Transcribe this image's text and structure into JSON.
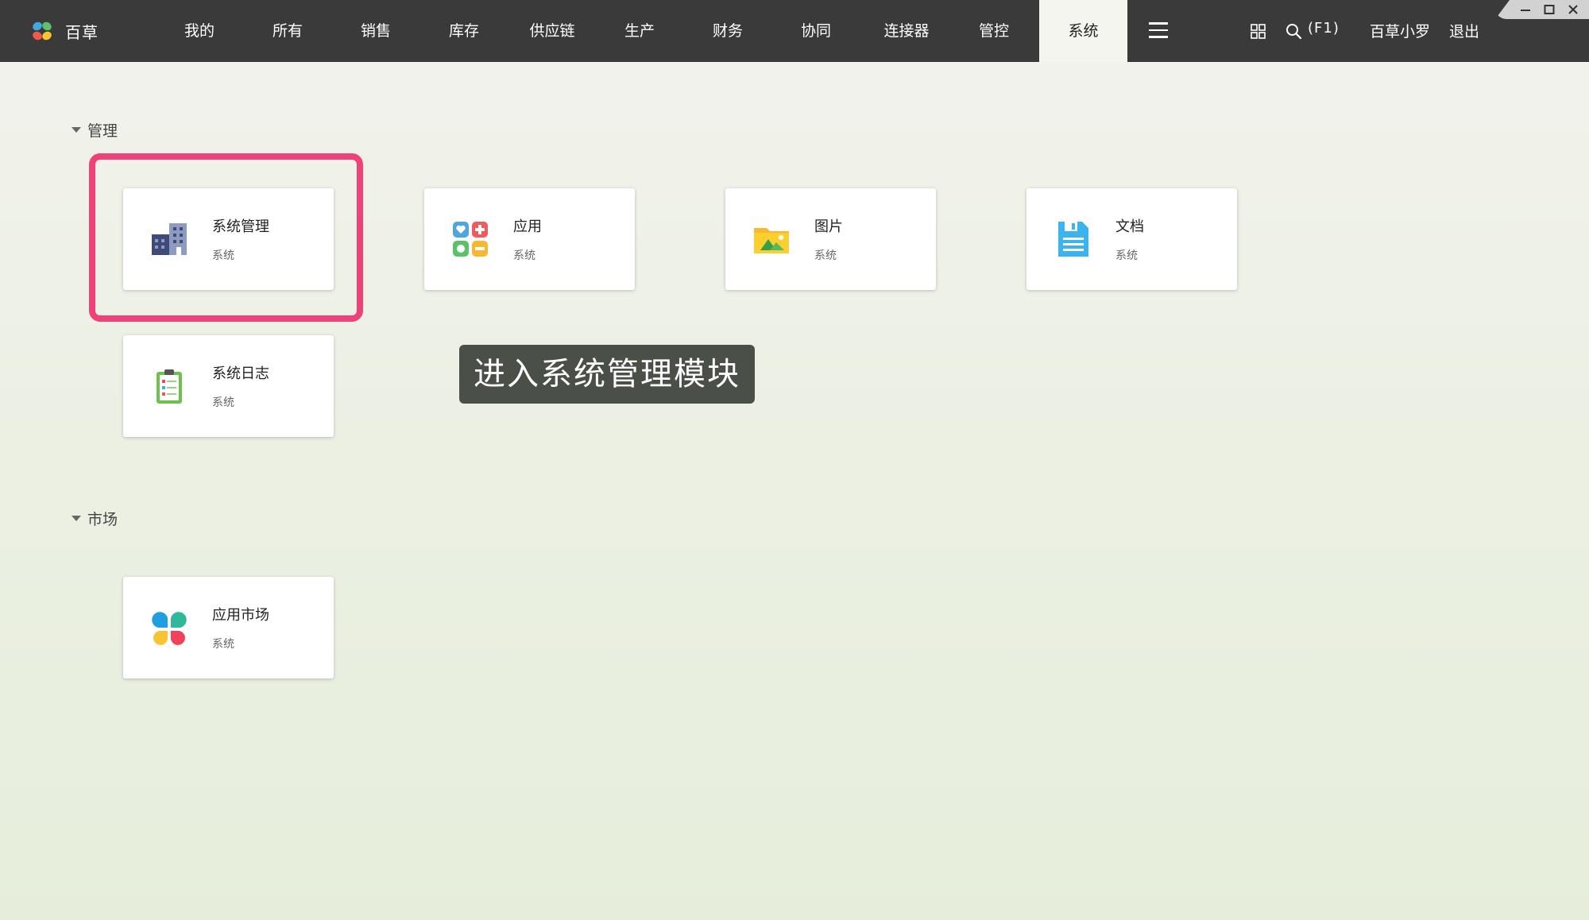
{
  "app": {
    "name": "百草"
  },
  "nav": {
    "items": [
      {
        "label": "我的"
      },
      {
        "label": "所有"
      },
      {
        "label": "销售"
      },
      {
        "label": "库存"
      },
      {
        "label": "供应链"
      },
      {
        "label": "生产"
      },
      {
        "label": "财务"
      },
      {
        "label": "协同"
      },
      {
        "label": "连接器"
      },
      {
        "label": "管控"
      },
      {
        "label": "系统",
        "active": true
      }
    ],
    "search_shortcut": "(F1)",
    "user": "百草小罗",
    "logout": "退出"
  },
  "sections": [
    {
      "title": "管理",
      "cards": [
        {
          "title": "系统管理",
          "subtitle": "系统",
          "icon": "building-icon"
        },
        {
          "title": "应用",
          "subtitle": "系统",
          "icon": "apps-icon"
        },
        {
          "title": "图片",
          "subtitle": "系统",
          "icon": "picture-folder-icon"
        },
        {
          "title": "文档",
          "subtitle": "系统",
          "icon": "document-icon"
        },
        {
          "title": "系统日志",
          "subtitle": "系统",
          "icon": "clipboard-icon"
        }
      ]
    },
    {
      "title": "市场",
      "cards": [
        {
          "title": "应用市场",
          "subtitle": "系统",
          "icon": "app-market-icon"
        }
      ]
    }
  ],
  "tooltip": "进入系统管理模块",
  "colors": {
    "topbar": "#3a3a3a",
    "highlight": "#f0427a",
    "tooltip_bg": "#4a4f48"
  }
}
